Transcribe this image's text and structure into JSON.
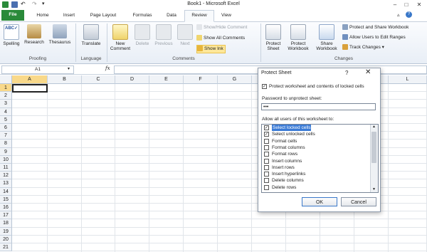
{
  "window": {
    "title": "Book1  -  Microsoft Excel"
  },
  "tabs": [
    "File",
    "Home",
    "Insert",
    "Page Layout",
    "Formulas",
    "Data",
    "Review",
    "View"
  ],
  "active_tab": "Review",
  "ribbon": {
    "proofing": {
      "label": "Proofing",
      "spelling": "Spelling",
      "research": "Research",
      "thesaurus": "Thesaurus"
    },
    "language": {
      "label": "Language",
      "translate": "Translate"
    },
    "comments": {
      "label": "Comments",
      "new_comment_line1": "New",
      "new_comment_line2": "Comment",
      "delete": "Delete",
      "previous": "Previous",
      "next": "Next",
      "show_hide_comment": "Show/Hide Comment",
      "show_all_comments": "Show All Comments",
      "show_ink": "Show Ink"
    },
    "changes": {
      "label": "Changes",
      "protect_sheet_line1": "Protect",
      "protect_sheet_line2": "Sheet",
      "protect_workbook_line1": "Protect",
      "protect_workbook_line2": "Workbook",
      "share_workbook_line1": "Share",
      "share_workbook_line2": "Workbook",
      "protect_and_share": "Protect and Share Workbook",
      "allow_users": "Allow Users to Edit Ranges",
      "track_changes": "Track Changes ▾"
    }
  },
  "formula_bar": {
    "name_box": "A1",
    "fx": "fx",
    "value": ""
  },
  "columns": [
    "A",
    "B",
    "C",
    "D",
    "E",
    "F",
    "G",
    "H",
    "I",
    "J",
    "K",
    "L"
  ],
  "rows": [
    "1",
    "2",
    "3",
    "4",
    "5",
    "6",
    "7",
    "8",
    "9",
    "10",
    "11",
    "12",
    "13",
    "14",
    "15",
    "16",
    "17",
    "18",
    "19",
    "20",
    "21"
  ],
  "dialog": {
    "title": "Protect Sheet",
    "help": "?",
    "close": "✕",
    "protect_option": "Protect worksheet and contents of locked cells",
    "protect_checked": true,
    "password_label": "Password to unprotect sheet:",
    "password_value": "•••",
    "allow_label": "Allow all users of this worksheet to:",
    "permissions": [
      {
        "label": "Select locked cells",
        "checked": true,
        "selected": true
      },
      {
        "label": "Select unlocked cells",
        "checked": true,
        "selected": false
      },
      {
        "label": "Format cells",
        "checked": false,
        "selected": false
      },
      {
        "label": "Format columns",
        "checked": false,
        "selected": false
      },
      {
        "label": "Format rows",
        "checked": false,
        "selected": false
      },
      {
        "label": "Insert columns",
        "checked": false,
        "selected": false
      },
      {
        "label": "Insert rows",
        "checked": false,
        "selected": false
      },
      {
        "label": "Insert hyperlinks",
        "checked": false,
        "selected": false
      },
      {
        "label": "Delete columns",
        "checked": false,
        "selected": false
      },
      {
        "label": "Delete rows",
        "checked": false,
        "selected": false
      }
    ],
    "ok_label": "OK",
    "cancel_label": "Cancel"
  },
  "colors": {
    "file_tab": "#2a8a3a",
    "selection": "#3b7bd6",
    "header_highlight": "#f9d98a",
    "show_ink_highlight": "#fde79a"
  }
}
